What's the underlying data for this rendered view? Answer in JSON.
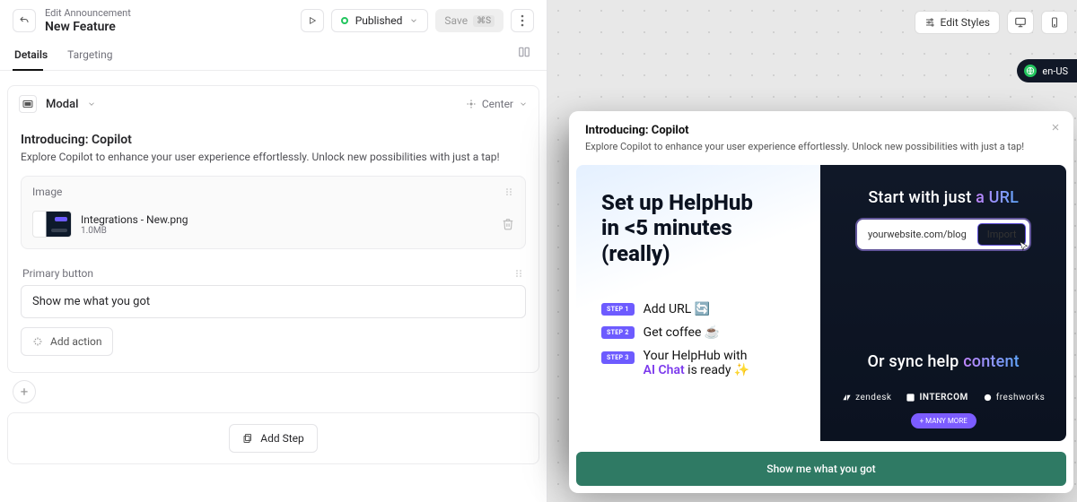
{
  "header": {
    "crumb": "Edit Announcement",
    "title": "New Feature",
    "status": "Published",
    "save_label": "Save",
    "save_kbd": "⌘S"
  },
  "tabs": {
    "details": "Details",
    "targeting": "Targeting"
  },
  "block": {
    "type": "Modal",
    "align": "Center",
    "title": "Introducing: Copilot",
    "subtitle": "Explore Copilot to enhance your user experience effortlessly. Unlock new possibilities with just a tap!",
    "image_section_label": "Image",
    "image_file": "Integrations - New.png",
    "image_size": "1.0MB",
    "primary_button_label": "Primary button",
    "primary_button_value": "Show me what you got",
    "add_action": "Add action",
    "add_step": "Add Step"
  },
  "canvas": {
    "edit_styles": "Edit Styles",
    "locale": "en-US"
  },
  "preview": {
    "title": "Introducing: Copilot",
    "desc": "Explore Copilot to enhance your user experience effortlessly. Unlock new possibilities with just a tap!",
    "left_headline_1": "Set up HelpHub",
    "left_headline_2": "in <5 minutes",
    "left_headline_3": "(really)",
    "step1": "Add URL 🔄",
    "step2": "Get coffee ☕",
    "step3_a": "Your HelpHub with",
    "step3_b": "AI Chat",
    "step3_c": " is ready ✨",
    "step_badge_1": "STEP 1",
    "step_badge_2": "STEP 2",
    "step_badge_3": "STEP 3",
    "right_h_a": "Start with just ",
    "right_h_b": "a URL",
    "url_placeholder": "yourwebsite.com/blog",
    "import": "Import",
    "or_a": "Or sync help ",
    "or_b": "content",
    "logo1": "zendesk",
    "logo2": "INTERCOM",
    "logo3": "freshworks",
    "many": "+ MANY MORE",
    "cta": "Show me what you got"
  }
}
